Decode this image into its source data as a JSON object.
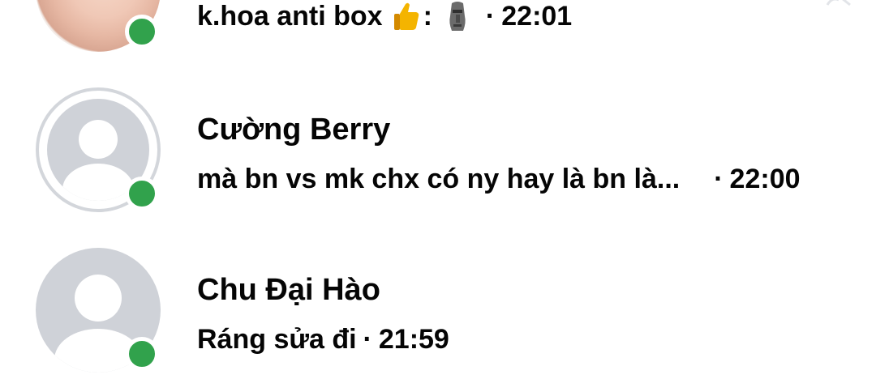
{
  "chats": [
    {
      "name": "",
      "message": "k.hoa anti box",
      "emojis": [
        "thumbs-up",
        "moai"
      ],
      "colon": ":",
      "separator": "·",
      "time": "22:01",
      "online": true,
      "avatar": "photo"
    },
    {
      "name": "Cường Berry",
      "message": "mà bn vs mk chx có ny hay là bn là...",
      "separator": "·",
      "time": "22:00",
      "online": true,
      "avatar": "default-ring"
    },
    {
      "name": "Chu Đại Hào",
      "message": "Ráng sửa đi",
      "separator": "·",
      "time": "21:59",
      "online": true,
      "avatar": "default"
    }
  ],
  "colors": {
    "online": "#31a24c",
    "text": "#050505",
    "avatar_bg": "#cfd2d8",
    "ring": "#d3d6db"
  }
}
